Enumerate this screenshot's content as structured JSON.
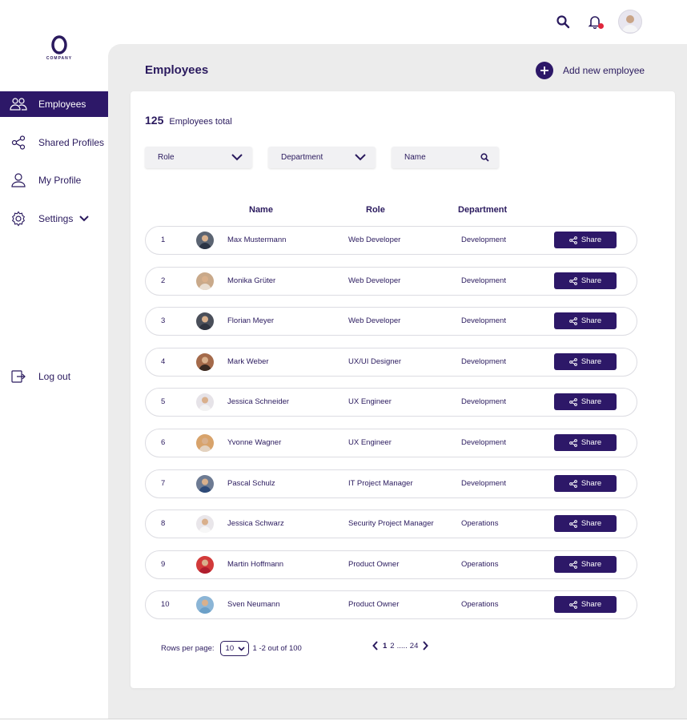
{
  "logo": {
    "text": "COMPANY"
  },
  "sidebar": {
    "items": [
      {
        "label": "Employees",
        "icon": "people-icon",
        "active": true
      },
      {
        "label": "Shared Profiles",
        "icon": "share-icon",
        "active": false
      },
      {
        "label": "My Profile",
        "icon": "user-icon",
        "active": false
      },
      {
        "label": "Settings",
        "icon": "gear-icon",
        "active": false
      }
    ],
    "logout_label": "Log out"
  },
  "header": {
    "title": "Employees",
    "add_label": "Add new employee"
  },
  "summary": {
    "count": "125",
    "label": "Employees total"
  },
  "filters": {
    "role": "Role",
    "department": "Department",
    "name": "Name"
  },
  "table": {
    "headers": {
      "name": "Name",
      "role": "Role",
      "department": "Department"
    },
    "share_label": "Share",
    "rows": [
      {
        "no": "1",
        "name": "Max Mustermann",
        "role": "Web Developer",
        "department": "Development"
      },
      {
        "no": "2",
        "name": "Monika Grüter",
        "role": "Web Developer",
        "department": "Development"
      },
      {
        "no": "3",
        "name": "Florian Meyer",
        "role": "Web Developer",
        "department": "Development"
      },
      {
        "no": "4",
        "name": "Mark Weber",
        "role": "UX/UI Designer",
        "department": "Development"
      },
      {
        "no": "5",
        "name": "Jessica Schneider",
        "role": "UX Engineer",
        "department": "Development"
      },
      {
        "no": "6",
        "name": "Yvonne Wagner",
        "role": "UX Engineer",
        "department": "Development"
      },
      {
        "no": "7",
        "name": "Pascal Schulz",
        "role": "IT Project Manager",
        "department": "Development"
      },
      {
        "no": "8",
        "name": "Jessica Schwarz",
        "role": "Security Project Manager",
        "department": "Operations"
      },
      {
        "no": "9",
        "name": "Martin Hoffmann",
        "role": "Product Owner",
        "department": "Operations"
      },
      {
        "no": "10",
        "name": "Sven Neumann",
        "role": "Product Owner",
        "department": "Operations"
      }
    ]
  },
  "pagination": {
    "rows_label": "Rows per page:",
    "rows_value": "10",
    "range": "1 -2 out of 100",
    "page_1": "1",
    "page_2": "2",
    "ellipsis": ".....",
    "page_last": "24"
  },
  "colors": {
    "accent": "#2d1868",
    "notification": "#e0263c",
    "background": "#ececec"
  }
}
